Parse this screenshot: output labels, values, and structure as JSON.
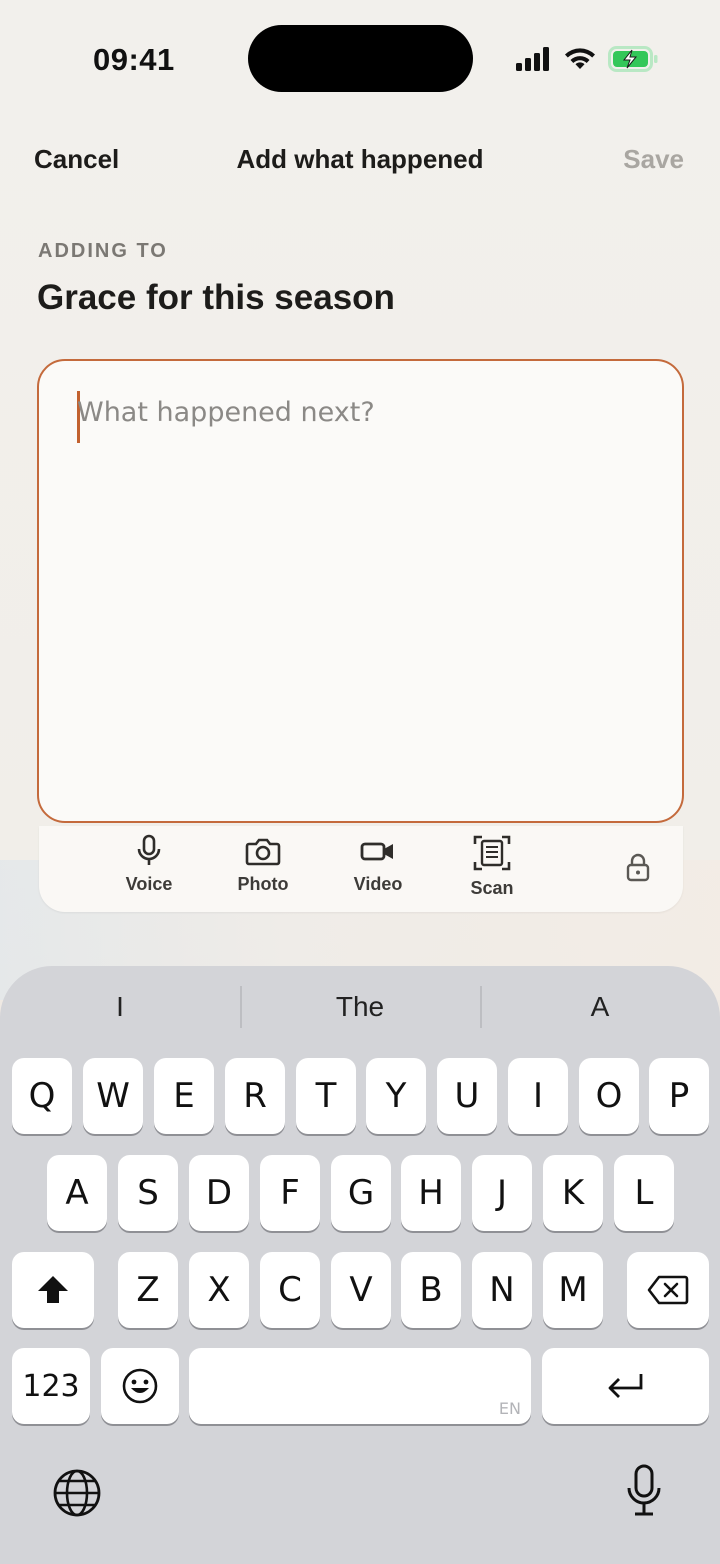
{
  "status": {
    "time": "09:41"
  },
  "nav": {
    "cancel": "Cancel",
    "title": "Add what happened",
    "save": "Save"
  },
  "context": {
    "label": "ADDING TO",
    "title": "Grace for this season"
  },
  "editor": {
    "placeholder": "What happened next?",
    "value": ""
  },
  "tools": [
    {
      "label": "Voice",
      "icon": "microphone-icon"
    },
    {
      "label": "Photo",
      "icon": "camera-icon"
    },
    {
      "label": "Video",
      "icon": "video-camera-icon"
    },
    {
      "label": "Scan",
      "icon": "document-scan-icon"
    }
  ],
  "keyboard": {
    "suggestions": [
      "I",
      "The",
      "A"
    ],
    "row1": [
      "Q",
      "W",
      "E",
      "R",
      "T",
      "Y",
      "U",
      "I",
      "O",
      "P"
    ],
    "row2": [
      "A",
      "S",
      "D",
      "F",
      "G",
      "H",
      "J",
      "K",
      "L"
    ],
    "row3": [
      "Z",
      "X",
      "C",
      "V",
      "B",
      "N",
      "M"
    ],
    "numbers": "123",
    "space_lang": "EN"
  },
  "colors": {
    "accent": "#c46a3c",
    "battery": "#34c759"
  }
}
